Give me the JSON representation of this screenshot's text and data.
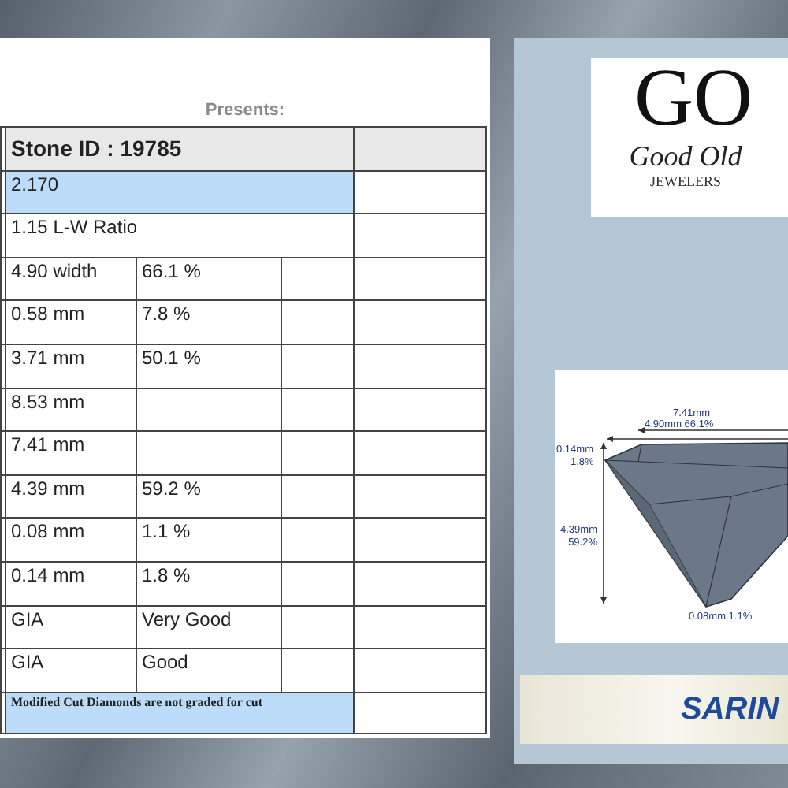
{
  "header": {
    "presents": "Presents:"
  },
  "rows": [
    {
      "kind": "header",
      "cells": [
        "Stone ID : 19785"
      ]
    },
    {
      "kind": "span",
      "highlighted": true,
      "cells": [
        "2.170"
      ]
    },
    {
      "kind": "span",
      "highlighted": false,
      "cells": [
        "1.15 L-W Ratio"
      ]
    },
    {
      "kind": "split",
      "cells": [
        "4.90 width",
        "66.1 %"
      ]
    },
    {
      "kind": "split",
      "cells": [
        "0.58 mm",
        "7.8 %"
      ]
    },
    {
      "kind": "split",
      "cells": [
        "3.71 mm",
        "50.1 %"
      ]
    },
    {
      "kind": "split",
      "cells": [
        "8.53 mm"
      ]
    },
    {
      "kind": "split",
      "cells": [
        "7.41 mm"
      ]
    },
    {
      "kind": "split",
      "cells": [
        "4.39 mm",
        "59.2 %"
      ]
    },
    {
      "kind": "split",
      "cells": [
        "0.08 mm",
        "1.1 %"
      ]
    },
    {
      "kind": "split",
      "cells": [
        "0.14 mm",
        "1.8 %"
      ]
    },
    {
      "kind": "split",
      "cells": [
        "GIA",
        "Very Good"
      ]
    },
    {
      "kind": "split",
      "cells": [
        "GIA",
        "Good"
      ]
    },
    {
      "kind": "note",
      "highlighted": true,
      "cells": [
        "Modified Cut Diamonds are not graded for cut"
      ]
    }
  ],
  "logo": {
    "monogram": "GO",
    "script": "Good Old",
    "subtitle": "JEWELERS"
  },
  "diagram": {
    "total_width": "7.41mm",
    "table_width": "4.90mm 66.1%",
    "crown_height": "0.14mm",
    "crown_pct": "1.8%",
    "pavilion_depth": "4.39mm",
    "pavilion_pct": "59.2%",
    "culet": "0.08mm 1.1%"
  },
  "banner": {
    "brand": "SARIN"
  }
}
